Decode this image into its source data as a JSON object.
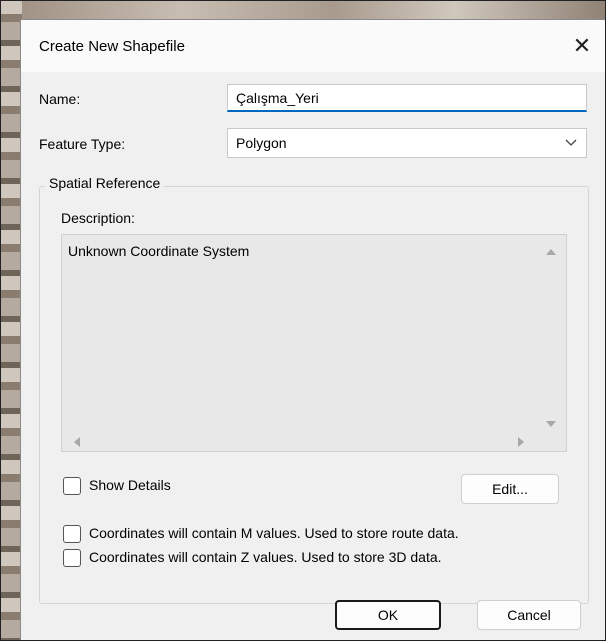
{
  "dialog": {
    "title": "Create New Shapefile",
    "close_icon": "close-icon"
  },
  "form": {
    "name_label": "Name:",
    "name_value": "Çalışma_Yeri",
    "feature_type_label": "Feature Type:",
    "feature_type_value": "Polygon"
  },
  "spatial_reference": {
    "group_label": "Spatial Reference",
    "description_label": "Description:",
    "description_text": "Unknown Coordinate System",
    "show_details_label": "Show Details",
    "edit_button": "Edit..."
  },
  "options": {
    "m_values_label": "Coordinates will contain M values. Used to store route data.",
    "z_values_label": "Coordinates will contain Z values. Used to store 3D data."
  },
  "footer": {
    "ok_button": "OK",
    "cancel_button": "Cancel"
  },
  "colors": {
    "accent": "#0067c0",
    "dialog_bg": "#f0f0f0"
  }
}
